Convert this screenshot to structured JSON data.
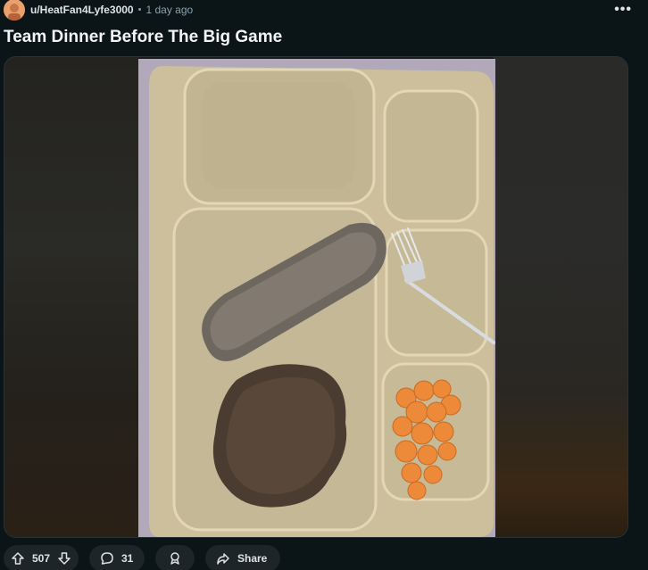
{
  "post": {
    "author": "u/HeatFan4Lyfe3000",
    "separator": "•",
    "time_ago": "1 day ago",
    "more_label": "•••",
    "title": "Team Dinner Before The Big Game"
  },
  "media": {
    "description_icon": "photo-of-cafeteria-tray"
  },
  "actions": {
    "vote_count": "507",
    "comment_count": "31",
    "share_label": "Share"
  },
  "colors": {
    "background": "#0b1416",
    "pill": "#1d2529",
    "text": "#f2f4f5",
    "muted": "#8ba2ad"
  }
}
